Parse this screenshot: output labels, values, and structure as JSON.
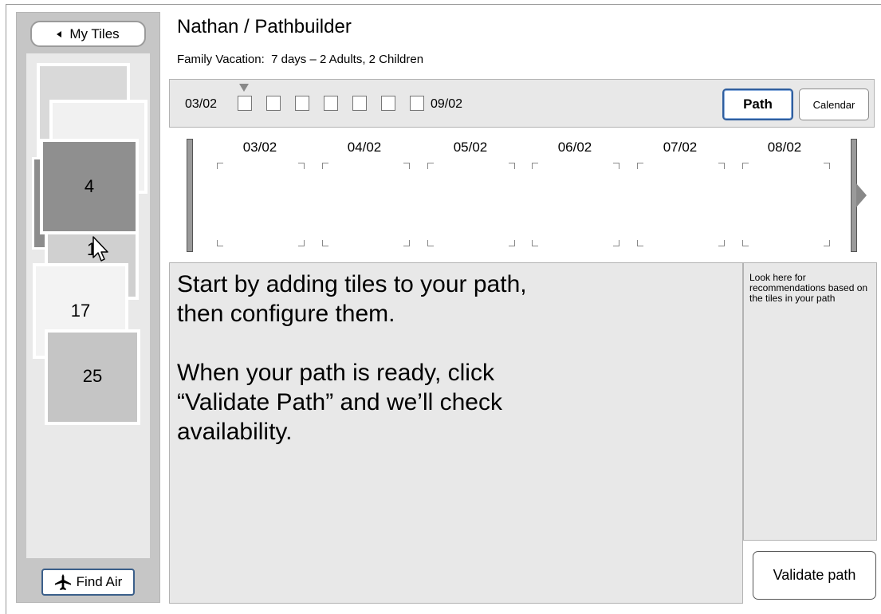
{
  "sidebar": {
    "my_tiles_label": "My Tiles",
    "find_air_label": "Find Air",
    "tiles": [
      "4",
      "1",
      "17",
      "25"
    ]
  },
  "header": {
    "title": "Nathan / Pathbuilder",
    "subtitle": "Family Vacation:  7 days – 2 Adults, 2 Children"
  },
  "date_strip": {
    "start": "03/02",
    "end": "09/02",
    "path_label": "Path",
    "calendar_label": "Calendar"
  },
  "timeline": {
    "days": [
      "03/02",
      "04/02",
      "05/02",
      "06/02",
      "07/02",
      "08/02"
    ]
  },
  "workspace": {
    "line1": "Start by adding tiles to your path,",
    "line2": "then configure them.",
    "line3": "When your path is ready, click",
    "line4": "“Validate Path” and we’ll check",
    "line5": "availability."
  },
  "recommendations": {
    "text": "Look here for recommendations based on the tiles in your path"
  },
  "validate_label": "Validate path",
  "colors": {
    "accent": "#2f5e9e",
    "panel": "#e8e8e8",
    "sidebar": "#c6c6c6"
  }
}
